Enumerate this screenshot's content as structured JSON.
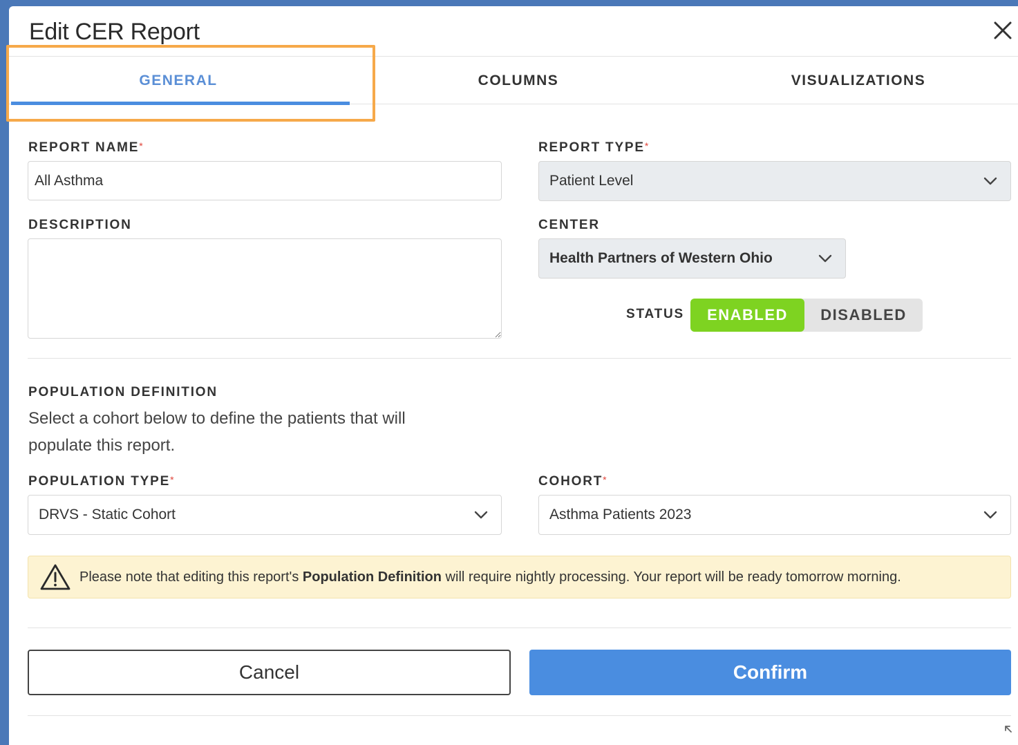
{
  "dialog": {
    "title": "Edit CER Report"
  },
  "tabs": [
    {
      "label": "GENERAL",
      "active": true
    },
    {
      "label": "COLUMNS",
      "active": false
    },
    {
      "label": "VISUALIZATIONS",
      "active": false
    }
  ],
  "form": {
    "report_name": {
      "label": "REPORT NAME",
      "required_mark": "*",
      "value": "All Asthma"
    },
    "report_type": {
      "label": "REPORT TYPE",
      "required_mark": "*",
      "value": "Patient Level"
    },
    "description": {
      "label": "DESCRIPTION",
      "value": ""
    },
    "center": {
      "label": "CENTER",
      "value": "Health Partners of Western Ohio"
    },
    "status": {
      "label": "STATUS",
      "enabled_label": "ENABLED",
      "disabled_label": "DISABLED",
      "selected": "ENABLED"
    }
  },
  "population": {
    "heading": "POPULATION DEFINITION",
    "description": "Select a cohort below to define the patients that will populate this report.",
    "population_type": {
      "label": "POPULATION TYPE",
      "required_mark": "*",
      "value": "DRVS - Static Cohort"
    },
    "cohort": {
      "label": "COHORT",
      "required_mark": "*",
      "value": "Asthma Patients 2023"
    }
  },
  "alert": {
    "text_before": "Please note that editing this report's ",
    "text_bold": "Population Definition",
    "text_after": " will require nightly processing. Your report will be ready tomorrow morning."
  },
  "footer": {
    "cancel_label": "Cancel",
    "confirm_label": "Confirm"
  },
  "colors": {
    "accent_blue": "#4a8de0",
    "enabled_green": "#7ed321",
    "highlight_orange": "#f6a94a",
    "warning_bg": "#fdf3d2",
    "required_red": "#e0443a"
  }
}
